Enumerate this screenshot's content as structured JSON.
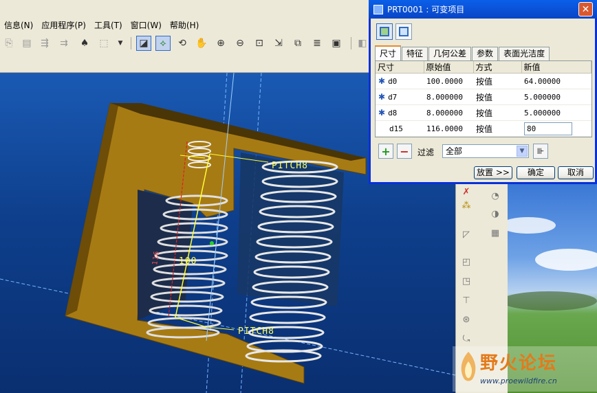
{
  "menubar": {
    "items": [
      "信息(N)",
      "应用程序(P)",
      "工具(T)",
      "窗口(W)",
      "帮助(H)"
    ]
  },
  "viewport": {
    "annotations": {
      "pitch_top": "PITCH8",
      "pitch_bottom": "PITCH8",
      "dim_height": "100",
      "dim_vertical": "116"
    }
  },
  "dialog": {
    "title": "PRT0001 : 可变项目",
    "close": "✕",
    "tabs": [
      "尺寸",
      "特征",
      "几何公差",
      "参数",
      "表面光洁度"
    ],
    "columns": [
      "尺寸",
      "原始值",
      "方式",
      "新值"
    ],
    "rows": [
      {
        "name": "d0",
        "orig": "100.0000",
        "mode": "按值",
        "new": "64.00000",
        "starred": true
      },
      {
        "name": "d7",
        "orig": "8.000000",
        "mode": "按值",
        "new": "5.000000",
        "starred": true
      },
      {
        "name": "d8",
        "orig": "8.000000",
        "mode": "按值",
        "new": "5.000000",
        "starred": true
      },
      {
        "name": "d15",
        "orig": "116.0000",
        "mode": "按值",
        "new": "80",
        "starred": false
      }
    ],
    "star_glyph": "✱",
    "add_label": "+",
    "remove_label": "−",
    "filter_label": "过滤",
    "filter_value": "全部",
    "filter_arrow": "▼",
    "buttons": {
      "place": "放置 >>",
      "ok": "确定",
      "cancel": "取消"
    }
  },
  "watermark": {
    "title": "野火论坛",
    "url": "www.proewildfire.cn"
  },
  "colors": {
    "model": "#a77b14",
    "model_dark": "#6d4d08",
    "viewport_bg": "#1a5ab4",
    "dialog_title": "#0b55db"
  }
}
